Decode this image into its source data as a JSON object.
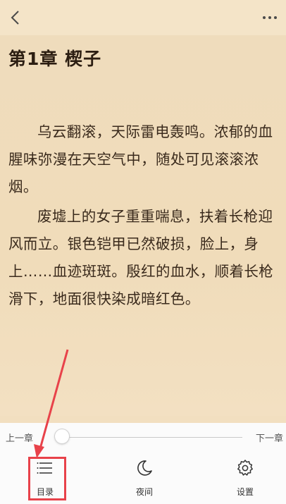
{
  "chapter": {
    "title": "第1章 楔子",
    "paragraphs": [
      "乌云翻滚，天际雷电轰鸣。浓郁的血腥味弥漫在天空气中，随处可见滚滚浓烟。",
      "废墟上的女子重重喘息，扶着长枪迎风而立。银色铠甲已然破损，脸上，身上……血迹斑斑。殷红的血水，顺着长枪滑下，地面很快染成暗红色。"
    ]
  },
  "progress": {
    "prev_label": "上一章",
    "next_label": "下一章",
    "value_percent": 0
  },
  "bottom_bar": {
    "tabs": [
      {
        "label": "目录",
        "icon": "list-icon"
      },
      {
        "label": "夜间",
        "icon": "moon-icon"
      },
      {
        "label": "设置",
        "icon": "gear-icon"
      }
    ]
  },
  "annotation": {
    "color": "#e8424a"
  }
}
